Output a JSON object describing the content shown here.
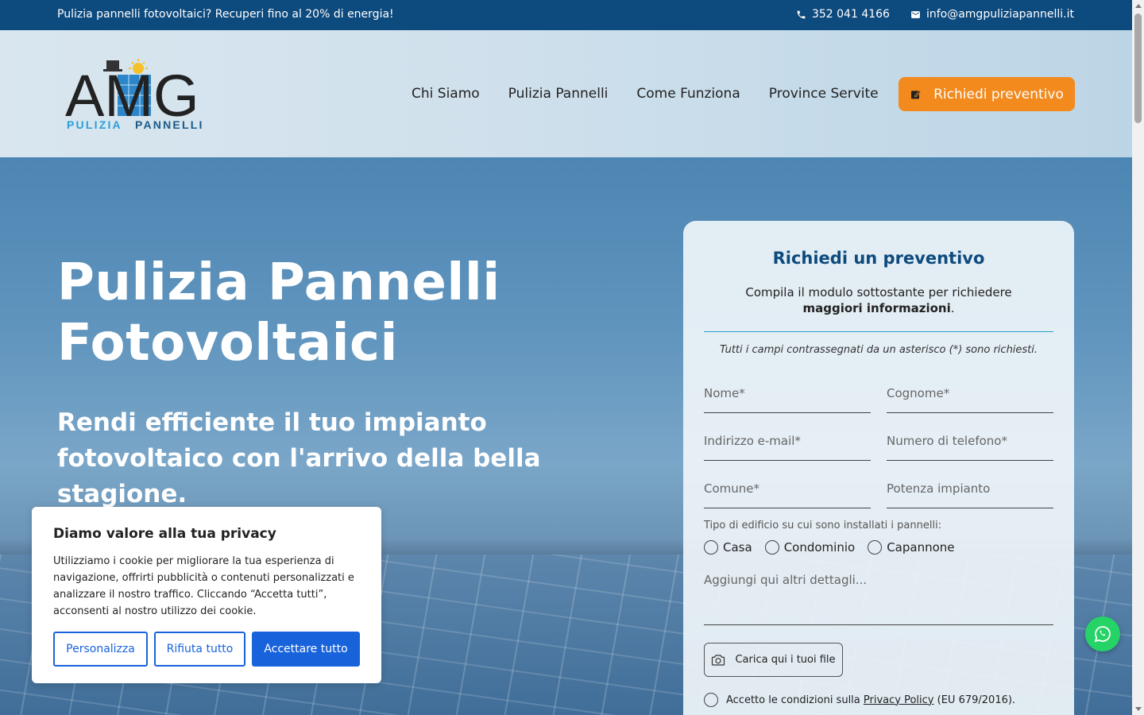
{
  "topbar": {
    "promo": "Pulizia pannelli fotovoltaici? Recuperi fino al 20% di energia!",
    "phone": "352 041 4166",
    "email": "info@amgpuliziapannelli.it"
  },
  "header": {
    "logo_main": "AMG",
    "logo_sub_a": "PULIZIA",
    "logo_sub_b": "PANNELLI",
    "nav": [
      "Chi Siamo",
      "Pulizia Pannelli",
      "Come Funziona",
      "Province Servite"
    ],
    "cta_label": "Richiedi preventivo"
  },
  "hero": {
    "title_line1": "Pulizia Pannelli",
    "title_line2": "Fotovoltaici",
    "subtitle": "Rendi efficiente il tuo impianto fotovoltaico con l'arrivo della bella stagione."
  },
  "form": {
    "title": "Richiedi un preventivo",
    "desc_plain": "Compila il modulo sottostante per richiedere ",
    "desc_bold": "maggiori informazioni",
    "desc_end": ".",
    "note": "Tutti i campi contrassegnati da un asterisco (*) sono richiesti.",
    "fields": {
      "nome": "Nome*",
      "cognome": "Cognome*",
      "email": "Indirizzo e-mail*",
      "telefono": "Numero di telefono*",
      "comune": "Comune*",
      "potenza": "Potenza impianto",
      "dettagli": "Aggiungi qui altri dettagli..."
    },
    "building_label": "Tipo di edificio su cui sono installati i pannelli:",
    "building_options": [
      "Casa",
      "Condominio",
      "Capannone"
    ],
    "upload_label": "Carica qui i tuoi file",
    "consent_pre": "Accetto le condizioni sulla ",
    "consent_link": "Privacy Policy",
    "consent_post": " (EU 679/2016)."
  },
  "cookie": {
    "title": "Diamo valore alla tua privacy",
    "text": "Utilizziamo i cookie per migliorare la tua esperienza di navigazione, offrirti pubblicità o contenuti personalizzati e analizzare il nostro traffico. Cliccando “Accetta tutti”, acconsenti al nostro utilizzo dei cookie.",
    "btn_customize": "Personalizza",
    "btn_reject": "Rifiuta tutto",
    "btn_accept": "Accettare tutto"
  },
  "colors": {
    "topbar": "#0d4a7e",
    "cta": "#f28a1e",
    "cookie_primary": "#1863dc",
    "whatsapp": "#25d366",
    "form_title": "#0d4a7e"
  },
  "icons": {
    "phone": "phone-icon",
    "email": "mail-icon",
    "cta": "edit-icon",
    "upload": "camera-icon",
    "whatsapp": "whatsapp-icon"
  }
}
